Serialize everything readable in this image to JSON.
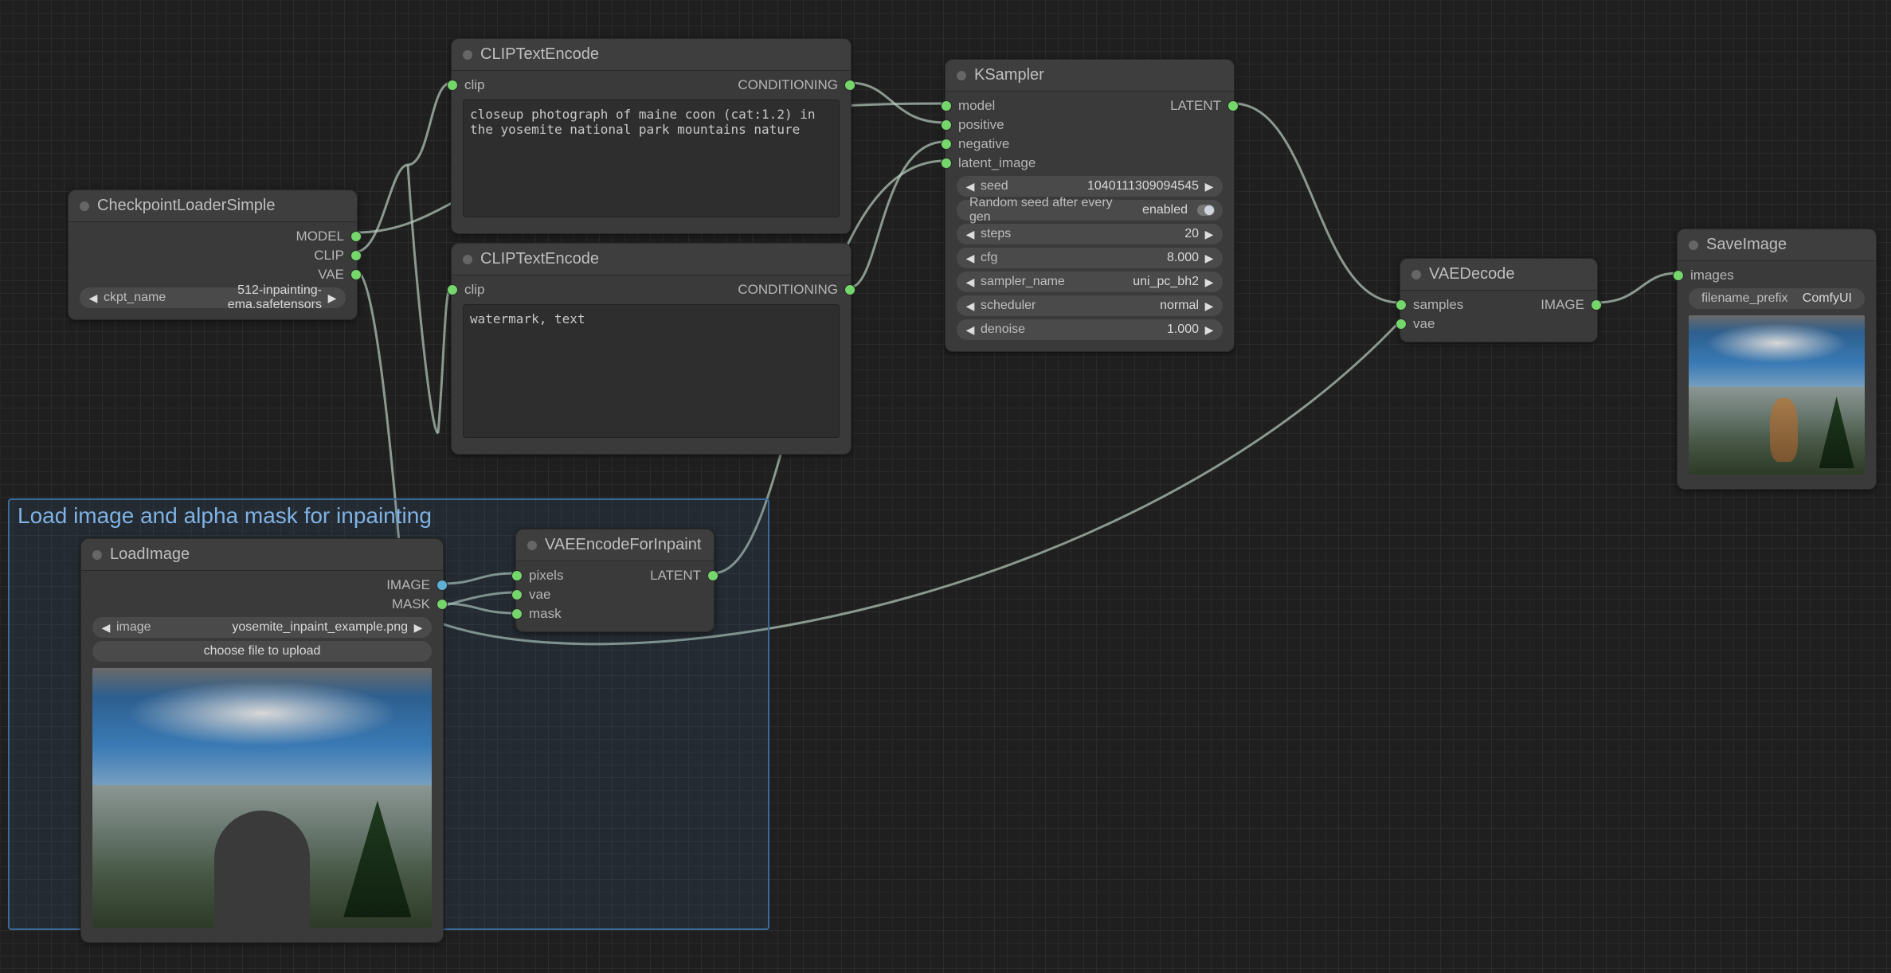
{
  "group": {
    "title": "Load image and alpha mask for inpainting"
  },
  "nodes": {
    "checkpoint": {
      "title": "CheckpointLoaderSimple",
      "outputs": [
        "MODEL",
        "CLIP",
        "VAE"
      ],
      "ckpt_label": "ckpt_name",
      "ckpt_value": "512-inpainting-ema.safetensors"
    },
    "clip_pos": {
      "title": "CLIPTextEncode",
      "input": "clip",
      "output": "CONDITIONING",
      "text": "closeup photograph of maine coon (cat:1.2) in the yosemite national park mountains nature"
    },
    "clip_neg": {
      "title": "CLIPTextEncode",
      "input": "clip",
      "output": "CONDITIONING",
      "text": "watermark, text"
    },
    "loadimage": {
      "title": "LoadImage",
      "outputs": [
        "IMAGE",
        "MASK"
      ],
      "image_label": "image",
      "image_value": "yosemite_inpaint_example.png",
      "upload": "choose file to upload"
    },
    "vae_encode": {
      "title": "VAEEncodeForInpaint",
      "inputs": [
        "pixels",
        "vae",
        "mask"
      ],
      "output": "LATENT"
    },
    "ksampler": {
      "title": "KSampler",
      "inputs": [
        "model",
        "positive",
        "negative",
        "latent_image"
      ],
      "output": "LATENT",
      "widgets": {
        "seed_label": "seed",
        "seed_value": "1040111309094545",
        "random_label": "Random seed after every gen",
        "random_value": "enabled",
        "steps_label": "steps",
        "steps_value": "20",
        "cfg_label": "cfg",
        "cfg_value": "8.000",
        "sampler_label": "sampler_name",
        "sampler_value": "uni_pc_bh2",
        "scheduler_label": "scheduler",
        "scheduler_value": "normal",
        "denoise_label": "denoise",
        "denoise_value": "1.000"
      }
    },
    "vae_decode": {
      "title": "VAEDecode",
      "inputs": [
        "samples",
        "vae"
      ],
      "output": "IMAGE"
    },
    "saveimage": {
      "title": "SaveImage",
      "input": "images",
      "prefix_label": "filename_prefix",
      "prefix_value": "ComfyUI"
    }
  }
}
